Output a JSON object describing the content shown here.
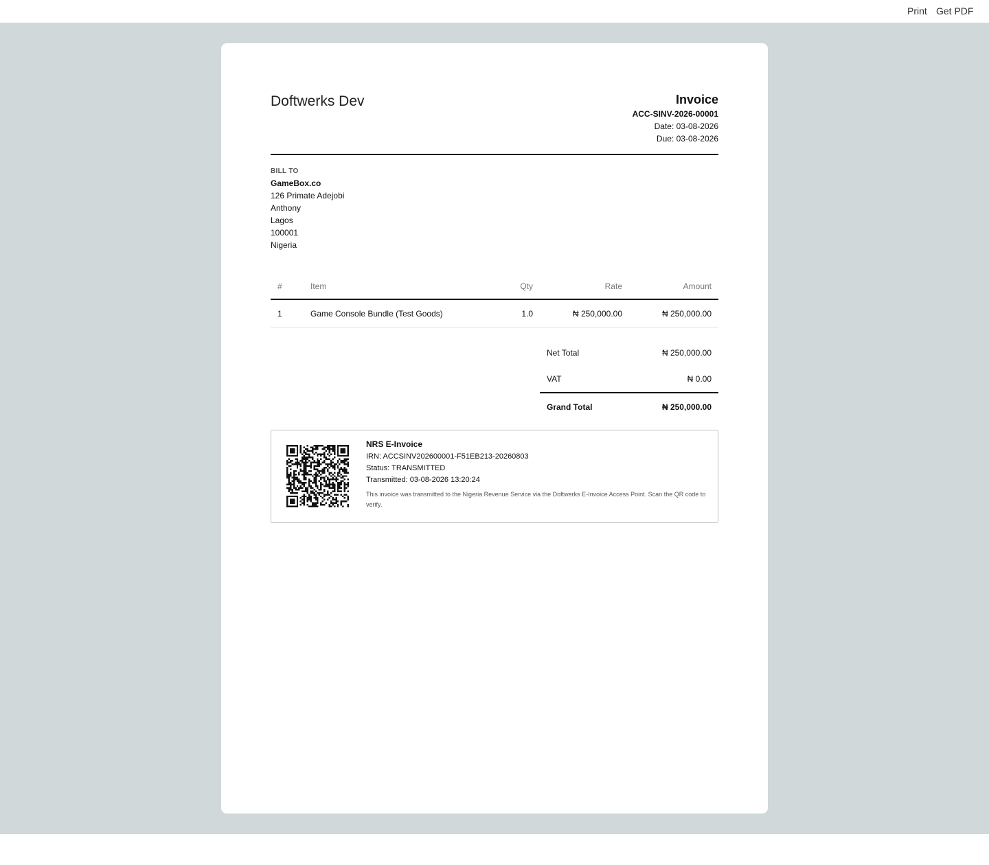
{
  "toolbar": {
    "print_label": "Print",
    "pdf_label": "Get PDF"
  },
  "company": "Doftwerks Dev",
  "invoice": {
    "title": "Invoice",
    "number": "ACC-SINV-2026-00001",
    "date": "Date: 03-08-2026",
    "due": "Due: 03-08-2026"
  },
  "bill_to": {
    "label": "BILL TO",
    "name": "GameBox.co",
    "lines": [
      "126 Primate Adejobi",
      "Anthony",
      "Lagos",
      "100001",
      "Nigeria"
    ]
  },
  "items_table": {
    "headers": [
      "#",
      "Item",
      "Qty",
      "Rate",
      "Amount"
    ],
    "rows": [
      [
        "1",
        "Game Console Bundle (Test Goods)",
        "1.0",
        "₦ 250,000.00",
        "₦ 250,000.00"
      ]
    ]
  },
  "totals": {
    "net_label": "Net Total",
    "net_value": "₦ 250,000.00",
    "vat_label": "VAT",
    "vat_value": "₦ 0.00",
    "grand_label": "Grand Total",
    "grand_value": "₦ 250,000.00"
  },
  "einvoice": {
    "title": "NRS E-Invoice",
    "irn": "IRN: ACCSINV202600001-F51EB213-20260803",
    "status": "Status: TRANSMITTED",
    "transmitted": "Transmitted: 03-08-2026 13:20:24",
    "note": "This invoice was transmitted to the Nigeria Revenue Service via the Doftwerks E-Invoice Access Point. Scan the QR code to verify."
  }
}
